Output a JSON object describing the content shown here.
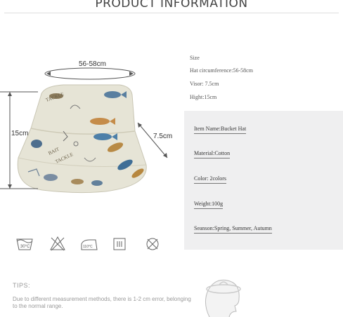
{
  "header": {
    "title": "PRODUCT INFORMATION"
  },
  "dimensions": {
    "circumference": "56-58cm",
    "height": "15cm",
    "visor": "7.5cm"
  },
  "size_info": {
    "heading": "Size",
    "circumference": "Hat circumference:56-58cm",
    "visor": "Visor: 7.5cm",
    "height": "Hight:15cm"
  },
  "specs": [
    "Item Name:Bucket Hat",
    "Material:Cotton",
    "Color: 2colors",
    "Weight:100g",
    "Seanson:Spring, Summer, Autumn"
  ],
  "care_icons": [
    {
      "icon": "wash-30-icon",
      "label": "30°C"
    },
    {
      "icon": "no-bleach-icon"
    },
    {
      "icon": "iron-110-icon",
      "label": "110°C"
    },
    {
      "icon": "dry-flat-icon"
    },
    {
      "icon": "no-dry-clean-icon"
    }
  ],
  "tips": {
    "heading": "TIPS:",
    "text": "Due to different measurement methods, there is 1-2 cm error, belonging to the normal range."
  },
  "colors": {
    "panel": "#efeff0",
    "hat_base": "#e8e6da",
    "text": "#333333"
  }
}
